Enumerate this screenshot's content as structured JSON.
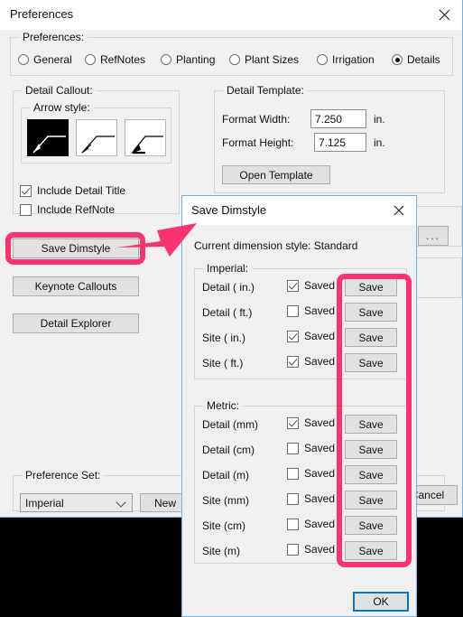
{
  "preferences_window": {
    "title": "Preferences",
    "close_icon": "close-icon",
    "prefs_group_label": "Preferences:",
    "tabs": [
      {
        "label": "General",
        "selected": false
      },
      {
        "label": "RefNotes",
        "selected": false
      },
      {
        "label": "Planting",
        "selected": false
      },
      {
        "label": "Plant Sizes",
        "selected": false
      },
      {
        "label": "Irrigation",
        "selected": false
      },
      {
        "label": "Details",
        "selected": true
      }
    ],
    "detail_callout": {
      "group_label": "Detail Callout:",
      "arrow_style_label": "Arrow style:",
      "arrow_styles": [
        {
          "name": "arrow-style-1",
          "selected": true
        },
        {
          "name": "arrow-style-2",
          "selected": false
        },
        {
          "name": "arrow-style-3",
          "selected": false
        }
      ],
      "checkboxes": [
        {
          "label": "Include Detail Title",
          "checked": true
        },
        {
          "label": "Include RefNote",
          "checked": false
        }
      ]
    },
    "detail_template": {
      "group_label": "Detail Template:",
      "format_width_label": "Format Width:",
      "format_width_value": "7.250",
      "format_width_unit": "in.",
      "format_height_label": "Format Height:",
      "format_height_value": "7.125",
      "format_height_unit": "in.",
      "open_template_label": "Open Template"
    },
    "left_buttons": [
      {
        "label": "Save Dimstyle",
        "highlighted": true
      },
      {
        "label": "Keynote Callouts",
        "highlighted": false
      },
      {
        "label": "Detail Explorer",
        "highlighted": false
      }
    ],
    "ellipsis_button_label": "...",
    "preference_set": {
      "group_label": "Preference Set:",
      "selected_value": "Imperial",
      "new_button_label": "New"
    },
    "cancel_button_label": "Cancel"
  },
  "save_dimstyle_dialog": {
    "title": "Save Dimstyle",
    "close_icon": "close-icon",
    "current_style_text": "Current dimension style: Standard",
    "imperial": {
      "group_label": "Imperial:",
      "rows": [
        {
          "label": "Detail ( in.)",
          "saved_label": "Saved",
          "checked": true,
          "save_label": "Save"
        },
        {
          "label": "Detail ( ft.)",
          "saved_label": "Saved",
          "checked": false,
          "save_label": "Save"
        },
        {
          "label": "Site ( in.)",
          "saved_label": "Saved",
          "checked": true,
          "save_label": "Save"
        },
        {
          "label": "Site ( ft.)",
          "saved_label": "Saved",
          "checked": true,
          "save_label": "Save"
        }
      ]
    },
    "metric": {
      "group_label": "Metric:",
      "rows": [
        {
          "label": "Detail (mm)",
          "saved_label": "Saved",
          "checked": true,
          "save_label": "Save"
        },
        {
          "label": "Detail (cm)",
          "saved_label": "Saved",
          "checked": false,
          "save_label": "Save"
        },
        {
          "label": "Detail (m)",
          "saved_label": "Saved",
          "checked": false,
          "save_label": "Save"
        },
        {
          "label": "Site (mm)",
          "saved_label": "Saved",
          "checked": false,
          "save_label": "Save"
        },
        {
          "label": "Site (cm)",
          "saved_label": "Saved",
          "checked": false,
          "save_label": "Save"
        },
        {
          "label": "Site (m)",
          "saved_label": "Saved",
          "checked": false,
          "save_label": "Save"
        }
      ]
    },
    "ok_button_label": "OK"
  },
  "annotations": {
    "highlight_color": "#f8336f",
    "arrow_name": "pink-pointer-arrow"
  }
}
